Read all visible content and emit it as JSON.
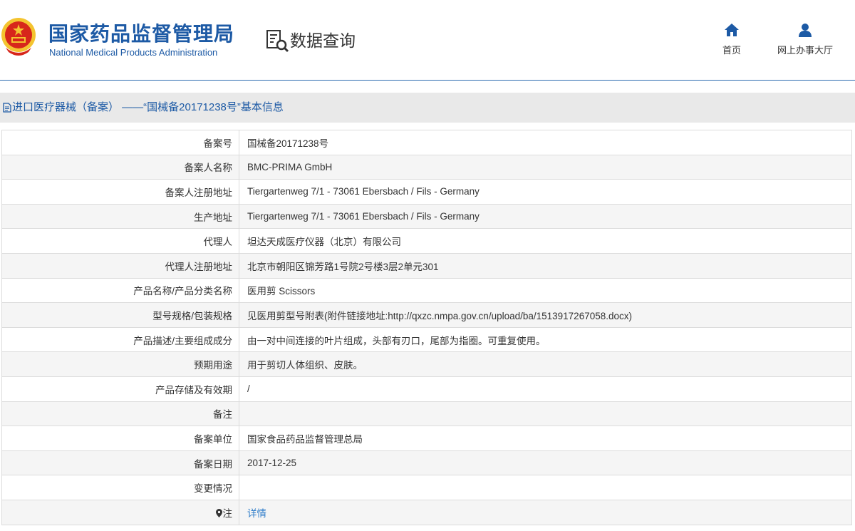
{
  "header": {
    "site_title_cn": "国家药品监督管理局",
    "site_title_en": "National Medical Products Administration",
    "query_label": "数据查询",
    "nav": {
      "home_label": "首页",
      "hall_label": "网上办事大厅"
    }
  },
  "page_title": "进口医疗器械（备案） ——“国械备20171238号”基本信息",
  "rows": [
    {
      "label": "备案号",
      "value": "国械备20171238号"
    },
    {
      "label": "备案人名称",
      "value": "BMC-PRIMA GmbH"
    },
    {
      "label": "备案人注册地址",
      "value": "Tiergartenweg 7/1 - 73061 Ebersbach / Fils - Germany"
    },
    {
      "label": "生产地址",
      "value": "Tiergartenweg 7/1 - 73061 Ebersbach / Fils - Germany"
    },
    {
      "label": "代理人",
      "value": "坦达天成医疗仪器（北京）有限公司"
    },
    {
      "label": "代理人注册地址",
      "value": "北京市朝阳区锦芳路1号院2号楼3层2单元301"
    },
    {
      "label": "产品名称/产品分类名称",
      "value": "医用剪 Scissors"
    },
    {
      "label": "型号规格/包装规格",
      "value": "见医用剪型号附表(附件链接地址:http://qxzc.nmpa.gov.cn/upload/ba/1513917267058.docx)"
    },
    {
      "label": "产品描述/主要组成成分",
      "value": "由一对中间连接的叶片组成，头部有刃口，尾部为指圈。可重复使用。"
    },
    {
      "label": "预期用途",
      "value": "用于剪切人体组织、皮肤。"
    },
    {
      "label": "产品存储及有效期",
      "value": "/"
    },
    {
      "label": "备注",
      "value": ""
    },
    {
      "label": "备案单位",
      "value": "国家食品药品监督管理总局"
    },
    {
      "label": "备案日期",
      "value": "2017-12-25"
    },
    {
      "label": "变更情况",
      "value": ""
    },
    {
      "label": "注",
      "value": "详情",
      "icon": "location-pin-icon"
    }
  ],
  "colors": {
    "brand_blue": "#1d5aa5",
    "link_blue": "#2d7cc9",
    "emblem_red": "#d7261b",
    "emblem_gold": "#f4c430"
  }
}
